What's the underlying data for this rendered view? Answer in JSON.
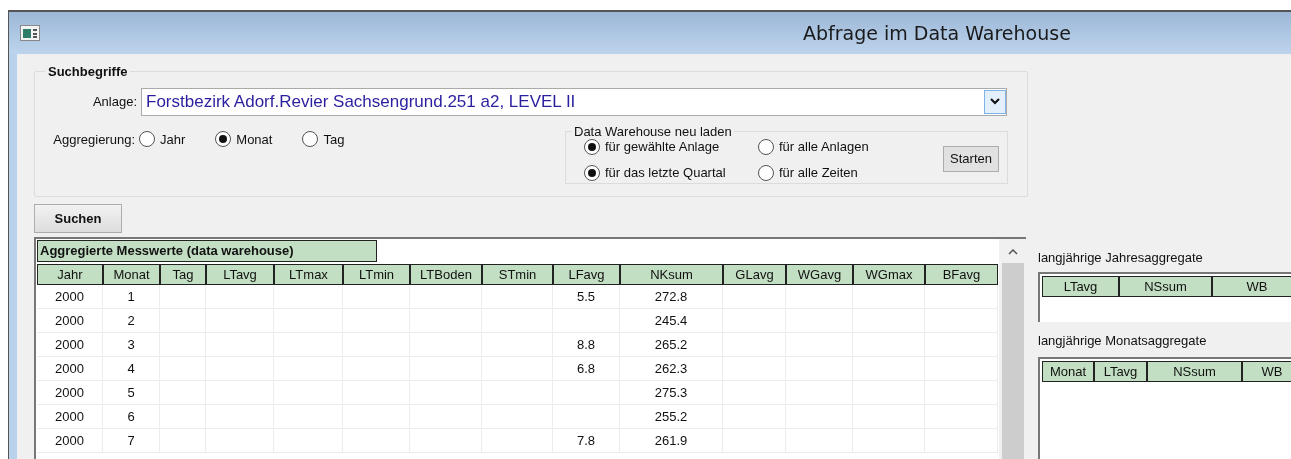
{
  "window": {
    "title": "Abfrage im Data Warehouse"
  },
  "search_group": {
    "title": "Suchbegriffe",
    "anlage_label": "Anlage:",
    "anlage_value": "Forstbezirk Adorf.Revier Sachsengrund.251 a2, LEVEL II",
    "aggregation_label": "Aggregierung:",
    "aggregation_options": [
      {
        "label": "Jahr",
        "selected": false
      },
      {
        "label": "Monat",
        "selected": true
      },
      {
        "label": "Tag",
        "selected": false
      }
    ],
    "reload_group": {
      "title": "Data Warehouse neu laden",
      "scope_options": [
        {
          "label": "für gewählte Anlage",
          "selected": true
        },
        {
          "label": "für alle Anlagen",
          "selected": false
        }
      ],
      "period_options": [
        {
          "label": "für das letzte Quartal",
          "selected": true
        },
        {
          "label": "für alle Zeiten",
          "selected": false
        }
      ],
      "button": "Starten"
    }
  },
  "search_button": "Suchen",
  "main_table": {
    "caption": "Aggregierte Messwerte (data warehouse)",
    "columns": [
      "Jahr",
      "Monat",
      "Tag",
      "LTavg",
      "LTmax",
      "LTmin",
      "LTBoden",
      "STmin",
      "LFavg",
      "NKsum",
      "GLavg",
      "WGavg",
      "WGmax",
      "BFavg"
    ],
    "rows": [
      [
        "2000",
        "1",
        null,
        null,
        null,
        null,
        null,
        null,
        "5.5",
        "272.8",
        null,
        null,
        null,
        null
      ],
      [
        "2000",
        "2",
        null,
        null,
        null,
        null,
        null,
        null,
        null,
        "245.4",
        null,
        null,
        null,
        null
      ],
      [
        "2000",
        "3",
        null,
        null,
        null,
        null,
        null,
        null,
        "8.8",
        "265.2",
        null,
        null,
        null,
        null
      ],
      [
        "2000",
        "4",
        null,
        null,
        null,
        null,
        null,
        null,
        "6.8",
        "262.3",
        null,
        null,
        null,
        null
      ],
      [
        "2000",
        "5",
        null,
        null,
        null,
        null,
        null,
        null,
        null,
        "275.3",
        null,
        null,
        null,
        null
      ],
      [
        "2000",
        "6",
        null,
        null,
        null,
        null,
        null,
        null,
        null,
        "255.2",
        null,
        null,
        null,
        null
      ],
      [
        "2000",
        "7",
        null,
        null,
        null,
        null,
        null,
        null,
        "7.8",
        "261.9",
        null,
        null,
        null,
        null
      ]
    ]
  },
  "year_aggregates": {
    "title": "langjährige Jahresaggregate",
    "columns": [
      "LTavg",
      "NSsum",
      "WB"
    ]
  },
  "month_aggregates": {
    "title": "langjährige Monatsaggregate",
    "columns": [
      "Monat",
      "LTavg",
      "NSsum",
      "WB"
    ]
  }
}
